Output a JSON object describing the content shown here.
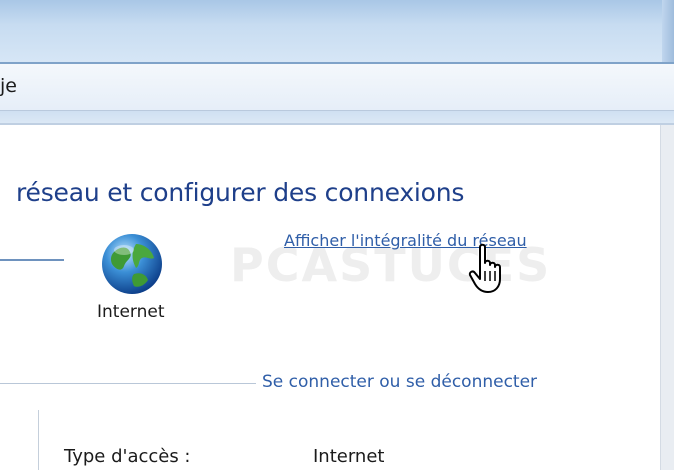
{
  "menubar": {
    "fragment": "je"
  },
  "heading": "réseau et configurer des connexions",
  "network_map": {
    "node_label": "Internet",
    "node_icon": "globe-icon",
    "view_full_map_link": "Afficher l'intégralité du réseau",
    "watermark": "PCASTUCES"
  },
  "section": {
    "connect_link": "Se connecter ou se déconnecter",
    "access_type_label": "Type d'accès :",
    "access_type_value": "Internet"
  },
  "colors": {
    "link": "#2f5ea8",
    "heading": "#1e3f8a",
    "titlebar": "#c7dcf1"
  }
}
